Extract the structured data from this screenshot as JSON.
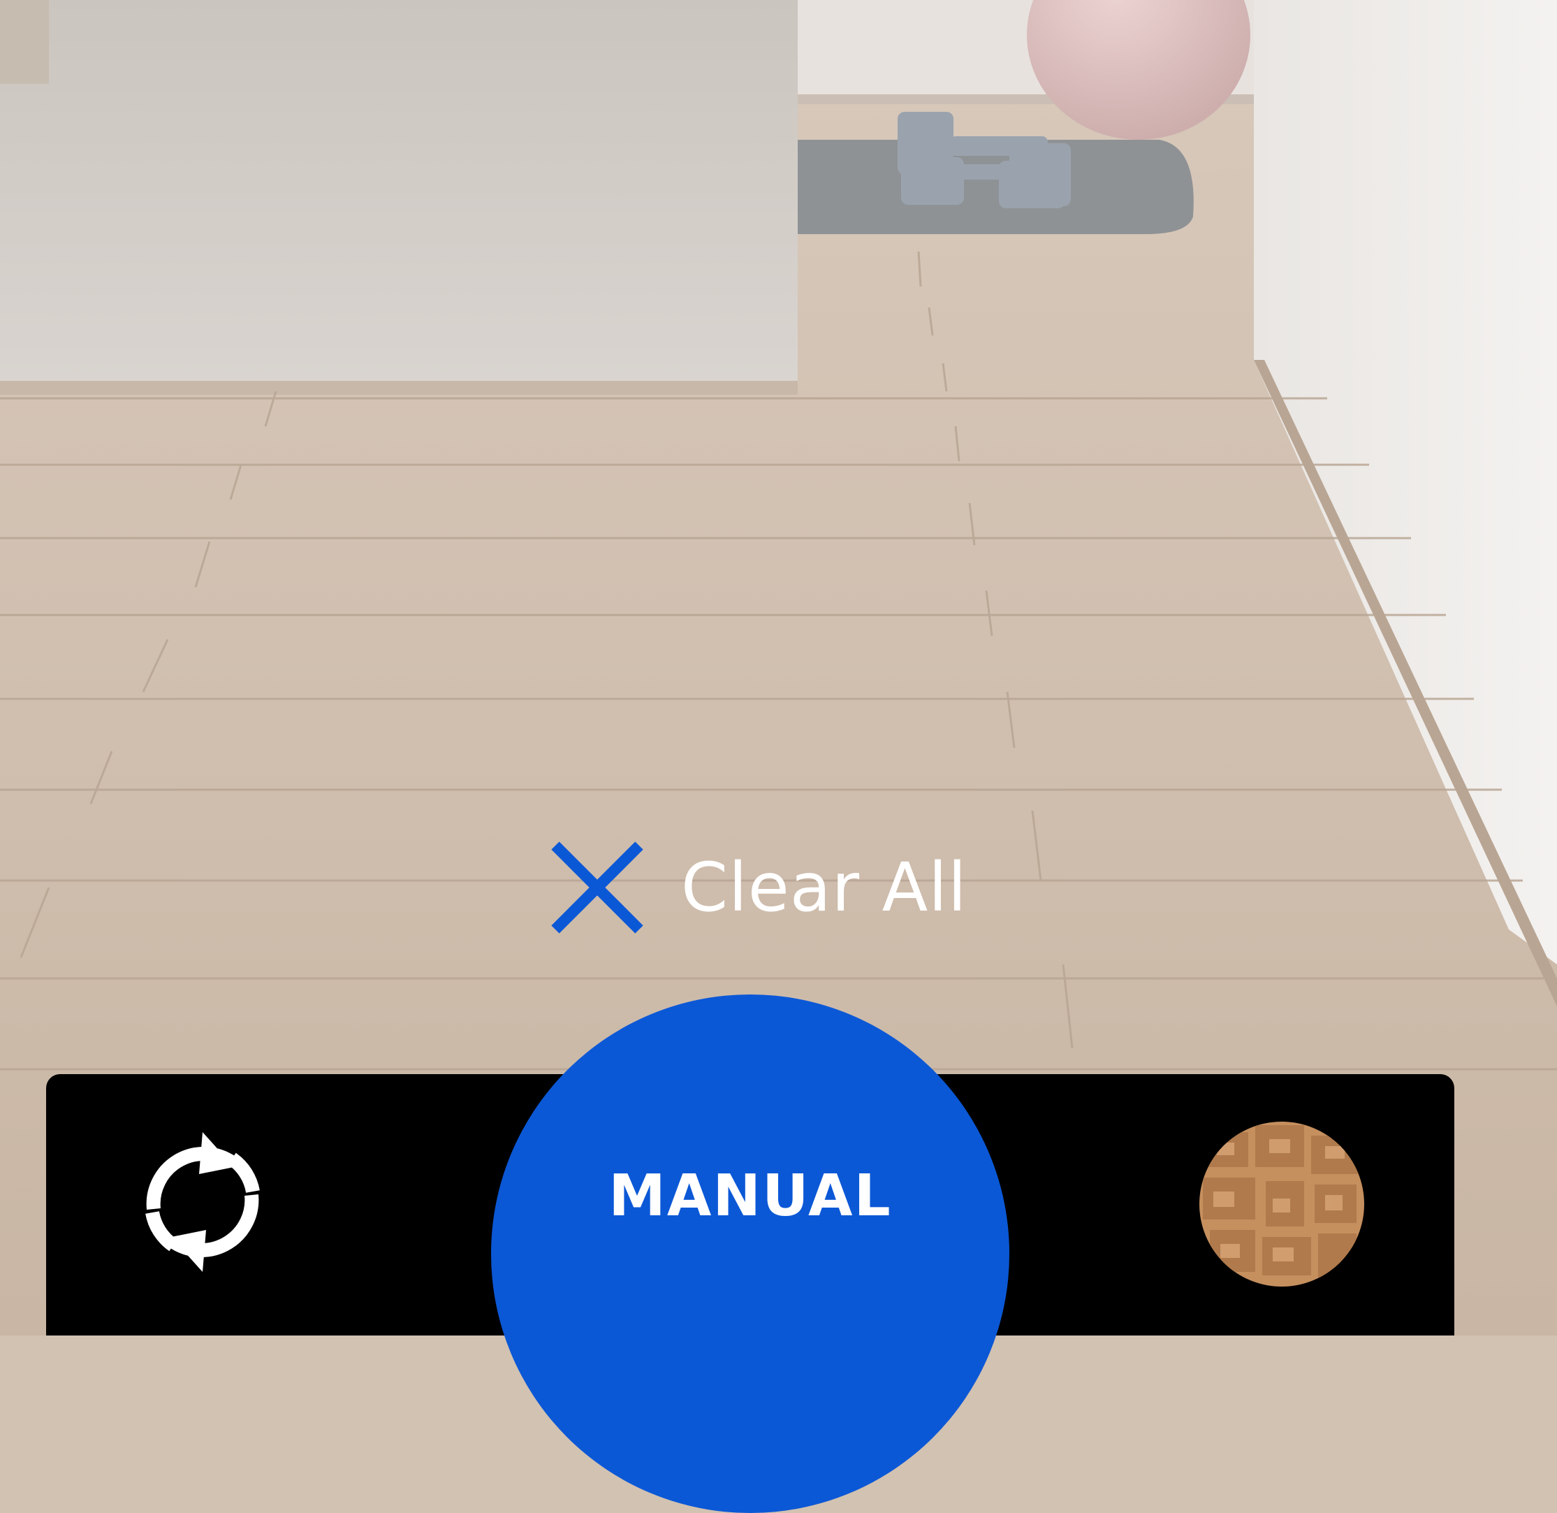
{
  "clear_all": {
    "label": "Clear All",
    "icon": "close-icon",
    "icon_color": "#0b58d6"
  },
  "toolbar": {
    "refresh_icon": "refresh-icon",
    "capture_button": {
      "label": "MANUAL",
      "color": "#0b58d6"
    },
    "texture_thumbnail": "stone-texture-thumbnail"
  },
  "colors": {
    "accent": "#0b58d6",
    "bar": "#000000",
    "text": "#ffffff"
  }
}
